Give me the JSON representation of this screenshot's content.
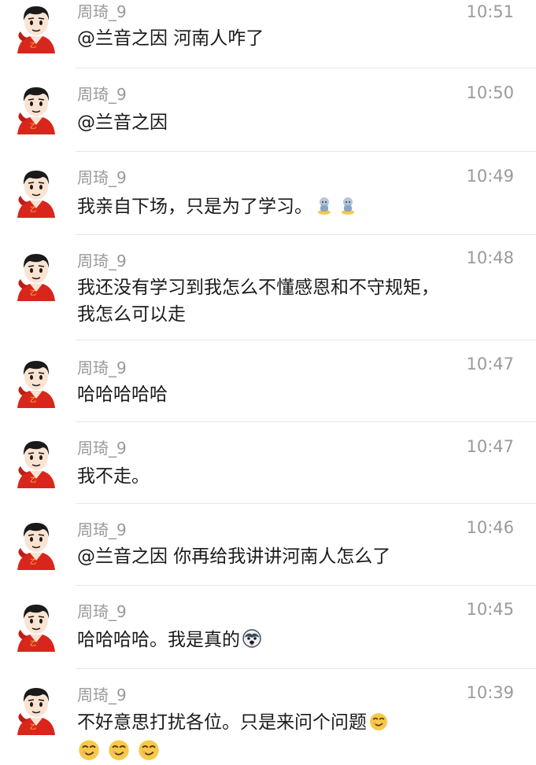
{
  "messages": [
    {
      "name": "周琦_9",
      "time": "10:51",
      "text": "@兰音之因 河南人咋了"
    },
    {
      "name": "周琦_9",
      "time": "10:50",
      "text": "@兰音之因"
    },
    {
      "name": "周琦_9",
      "time": "10:49",
      "text": "我亲自下场，只是为了学习。",
      "trailing_emojis": [
        "crying-figure-emoji",
        "crying-figure-emoji"
      ]
    },
    {
      "name": "周琦_9",
      "time": "10:48",
      "text": "我还没有学习到我怎么不懂感恩和不守规矩，我怎么可以走"
    },
    {
      "name": "周琦_9",
      "time": "10:47",
      "text": "哈哈哈哈哈"
    },
    {
      "name": "周琦_9",
      "time": "10:47",
      "text": "我不走。"
    },
    {
      "name": "周琦_9",
      "time": "10:46",
      "text": "@兰音之因 你再给我讲讲河南人怎么了"
    },
    {
      "name": "周琦_9",
      "time": "10:45",
      "text": "哈哈哈哈。我是真的",
      "trailing_emojis": [
        "husky-face-emoji"
      ]
    },
    {
      "name": "周琦_9",
      "time": "10:39",
      "text": "不好意思打扰各位。只是来问个问题",
      "trailing_emojis": [
        "doge-face-emoji"
      ],
      "extra_emojis": [
        "doge-face-emoji",
        "doge-face-emoji",
        "doge-face-emoji"
      ]
    }
  ],
  "colors": {
    "name": "#9a9a9a",
    "time": "#9a9a9a",
    "text": "#1a1a1a",
    "divider": "#e6e6e6",
    "avatar_shirt": "#d9261c"
  }
}
